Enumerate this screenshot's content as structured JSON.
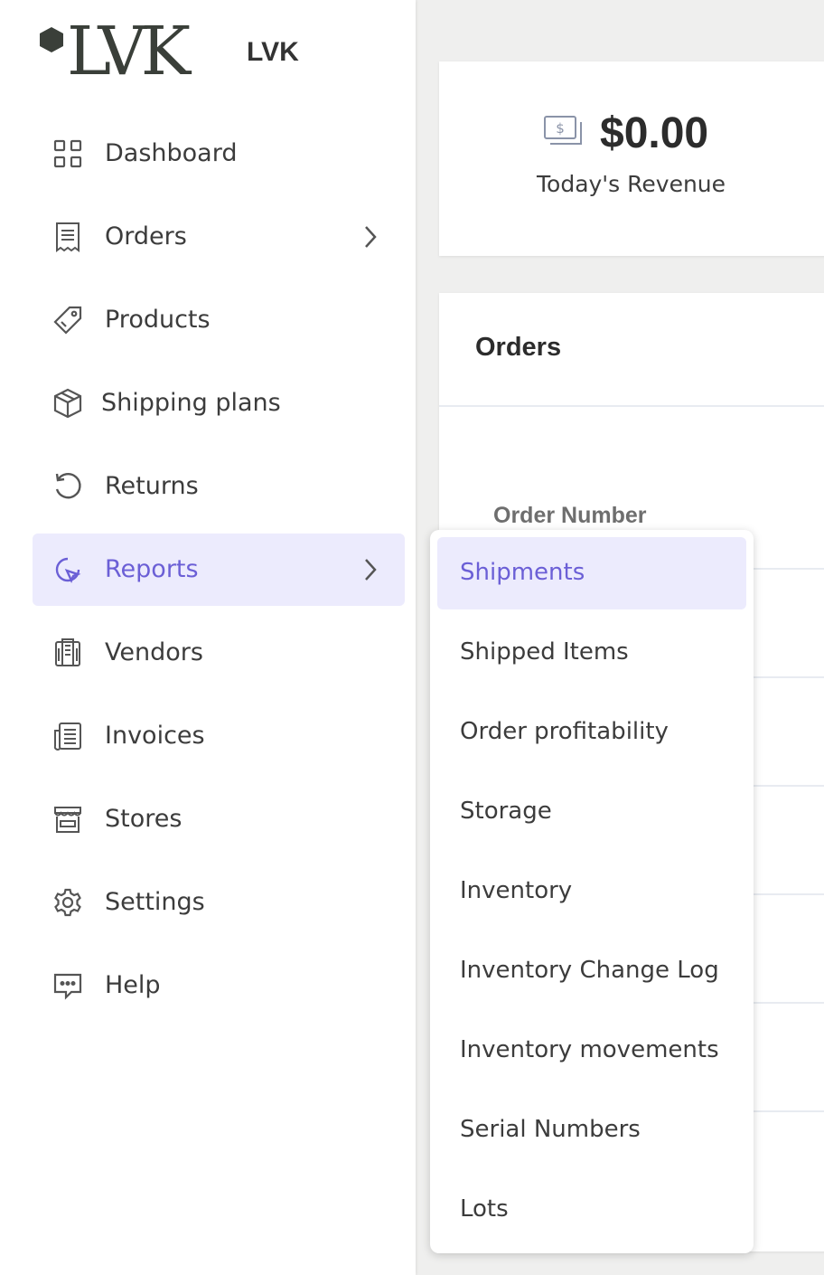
{
  "brand": {
    "logo_text": "LVK",
    "name": "LVK"
  },
  "sidebar": {
    "items": [
      {
        "label": "Dashboard",
        "icon": "grid-icon"
      },
      {
        "label": "Orders",
        "icon": "receipt-icon",
        "has_submenu": true
      },
      {
        "label": "Products",
        "icon": "tag-icon"
      },
      {
        "label": "Shipping plans",
        "icon": "box-icon"
      },
      {
        "label": "Returns",
        "icon": "rotate-icon"
      },
      {
        "label": "Reports",
        "icon": "pie-chart-icon",
        "has_submenu": true,
        "active": true
      },
      {
        "label": "Vendors",
        "icon": "building-icon"
      },
      {
        "label": "Invoices",
        "icon": "document-icon"
      },
      {
        "label": "Stores",
        "icon": "storefront-icon"
      },
      {
        "label": "Settings",
        "icon": "gear-icon"
      },
      {
        "label": "Help",
        "icon": "chat-icon"
      }
    ]
  },
  "revenue": {
    "amount": "$0.00",
    "label": "Today's Revenue",
    "icon": "money-icon"
  },
  "orders_card": {
    "title": "Orders",
    "column_header": "Order Number"
  },
  "reports_menu": {
    "items": [
      {
        "label": "Shipments",
        "active": true
      },
      {
        "label": "Shipped Items"
      },
      {
        "label": "Order profitability"
      },
      {
        "label": "Storage"
      },
      {
        "label": "Inventory"
      },
      {
        "label": "Inventory Change Log"
      },
      {
        "label": "Inventory movements"
      },
      {
        "label": "Serial Numbers"
      },
      {
        "label": "Lots"
      }
    ]
  },
  "colors": {
    "accent": "#6b5fd6",
    "active_bg": "#ecebfd",
    "text": "#3c3c3c",
    "background": "#efefee"
  }
}
